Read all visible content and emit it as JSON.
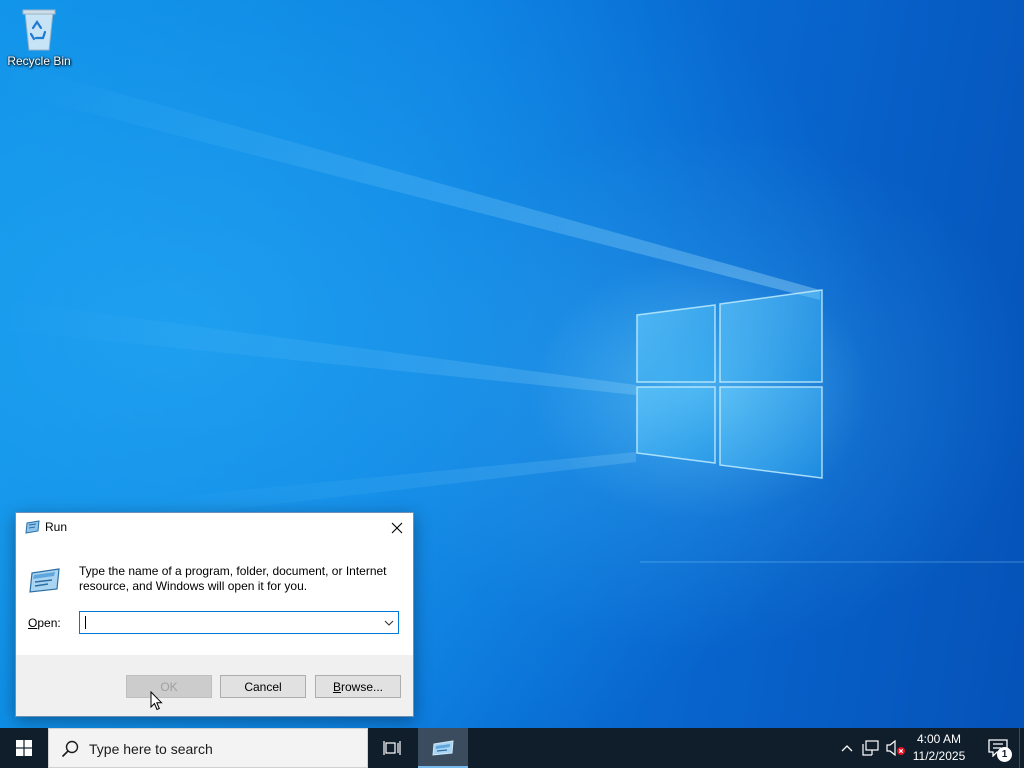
{
  "desktop": {
    "icons": [
      {
        "label": "Recycle Bin",
        "icon": "recycle-bin-icon"
      }
    ]
  },
  "run_dialog": {
    "title": "Run",
    "description": "Type the name of a program, folder, document, or Internet resource, and Windows will open it for you.",
    "open_label_prefix": "O",
    "open_label_rest": "pen:",
    "open_value": "",
    "buttons": {
      "ok": "OK",
      "cancel": "Cancel",
      "browse_prefix": "B",
      "browse_rest": "rowse..."
    },
    "ok_enabled": false
  },
  "taskbar": {
    "search_placeholder": "Type here to search",
    "running_apps": [
      {
        "name": "Run",
        "active": true
      }
    ],
    "clock": {
      "time": "4:00 AM",
      "date": "11/2/2025"
    },
    "notification_count": "1",
    "accent_color": "#0078d7"
  }
}
